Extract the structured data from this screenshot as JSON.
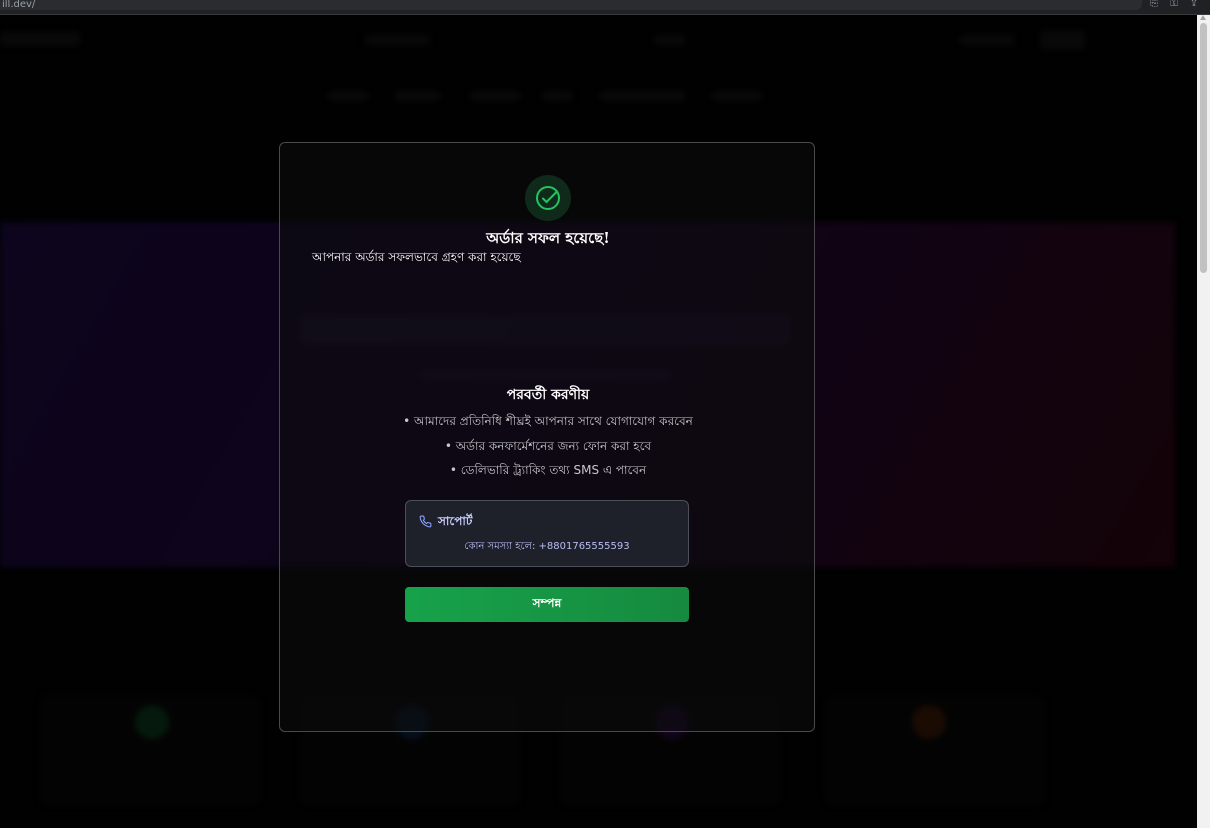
{
  "browser": {
    "url": "ill.dev/"
  },
  "modal": {
    "title": "অর্ডার সফল হয়েছে!",
    "subtitle": "আপনার অর্ডার সফলভাবে গ্রহণ করা হয়েছে",
    "next_steps_title": "পরবর্তী করণীয়",
    "next_steps": [
      "• আমাদের প্রতিনিধি শীঘ্রই আপনার সাথে যোগাযোগ করবেন",
      "• অর্ডার কনফার্মেশনের জন্য ফোন করা হবে",
      "• ডেলিভারি ট্র্যাকিং তথ্য SMS এ পাবেন"
    ],
    "support": {
      "icon": "phone-icon",
      "title": "সাপোর্ট",
      "text": "কোন সমস্যা হলে: +8801765555593"
    },
    "done_label": "সম্পন্ন"
  },
  "colors": {
    "success": "#22c55e",
    "button": "#16a34a",
    "support_text": "#c6cbff"
  }
}
